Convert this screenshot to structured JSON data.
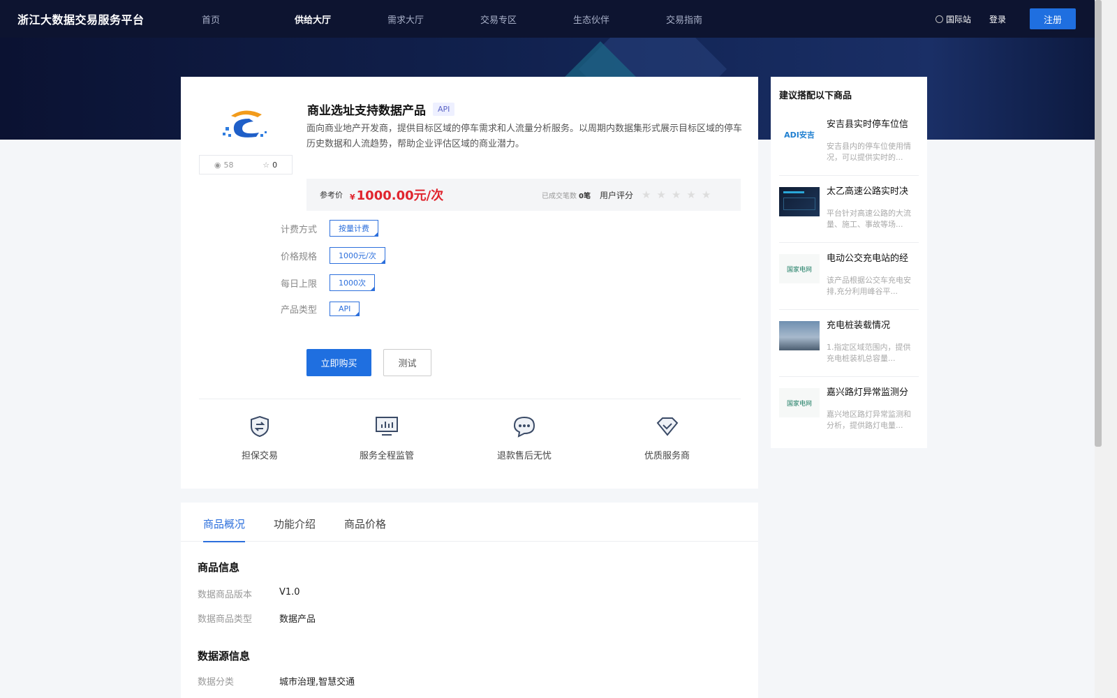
{
  "header": {
    "brand": "浙江大数据交易服务平台",
    "nav": [
      "首页",
      "供给大厅",
      "需求大厅",
      "交易专区",
      "生态伙伴",
      "交易指南"
    ],
    "active_nav": "供给大厅",
    "intl_label": "国际站",
    "login_label": "登录",
    "register_label": "注册"
  },
  "product": {
    "title": "商业选址支持数据产品",
    "tag": "API",
    "description": "面向商业地产开发商，提供目标区域的停车需求和人流量分析服务。以周期内数据集形式展示目标区域的停车历史数据和人流趋势，帮助企业评估区域的商业潜力。",
    "views": "58",
    "favorites": "0",
    "price_label": "参考价",
    "price_currency": "¥",
    "price": "1000.00元/次",
    "deals_label": "已成交笔数",
    "deals_count": "0笔",
    "rating_label": "用户评分",
    "rating": 0,
    "rating_max": 5,
    "specs": [
      {
        "label": "计费方式",
        "value": "按量计费"
      },
      {
        "label": "价格规格",
        "value": "1000元/次"
      },
      {
        "label": "每日上限",
        "value": "1000次"
      },
      {
        "label": "产品类型",
        "value": "API"
      }
    ],
    "buy_label": "立即购买",
    "test_label": "测试",
    "guarantees": [
      {
        "label": "担保交易",
        "icon": "shield-exchange-icon"
      },
      {
        "label": "服务全程监管",
        "icon": "monitor-chart-icon"
      },
      {
        "label": "退款售后无忧",
        "icon": "chat-bubble-icon"
      },
      {
        "label": "优质服务商",
        "icon": "diamond-check-icon"
      }
    ]
  },
  "details": {
    "tabs": [
      "商品概况",
      "功能介绍",
      "商品价格"
    ],
    "active_tab": "商品概况",
    "info_title": "商品信息",
    "info_rows": [
      {
        "key": "数据商品版本",
        "value": "V1.0"
      },
      {
        "key": "数据商品类型",
        "value": "数据产品"
      }
    ],
    "source_title": "数据源信息",
    "source_rows": [
      {
        "key": "数据分类",
        "value": "城市治理,智慧交通"
      }
    ]
  },
  "sidebar": {
    "title": "建议搭配以下商品",
    "items": [
      {
        "title": "安吉县实时停车位信",
        "desc": "安吉县内的停车位使用情况，可以提供实时的...",
        "thumb_text": "ADI安吉"
      },
      {
        "title": "太乙高速公路实时决",
        "desc": "平台针对高速公路的大流量、施工、事故等场...",
        "thumb_text": ""
      },
      {
        "title": "电动公交充电站的经",
        "desc": "该产品根据公交车充电安排,充分利用峰谷平...",
        "thumb_text": "国家电网"
      },
      {
        "title": "充电桩装载情况",
        "desc": "1.指定区域范围内，提供充电桩装机总容量...",
        "thumb_text": ""
      },
      {
        "title": "嘉兴路灯异常监测分",
        "desc": "嘉兴地区路灯异常监测和分析，提供路灯电量...",
        "thumb_text": "国家电网"
      }
    ]
  },
  "colors": {
    "primary": "#1f6fe0",
    "header_bg": "#0d1430",
    "price_red": "#e0252e"
  }
}
